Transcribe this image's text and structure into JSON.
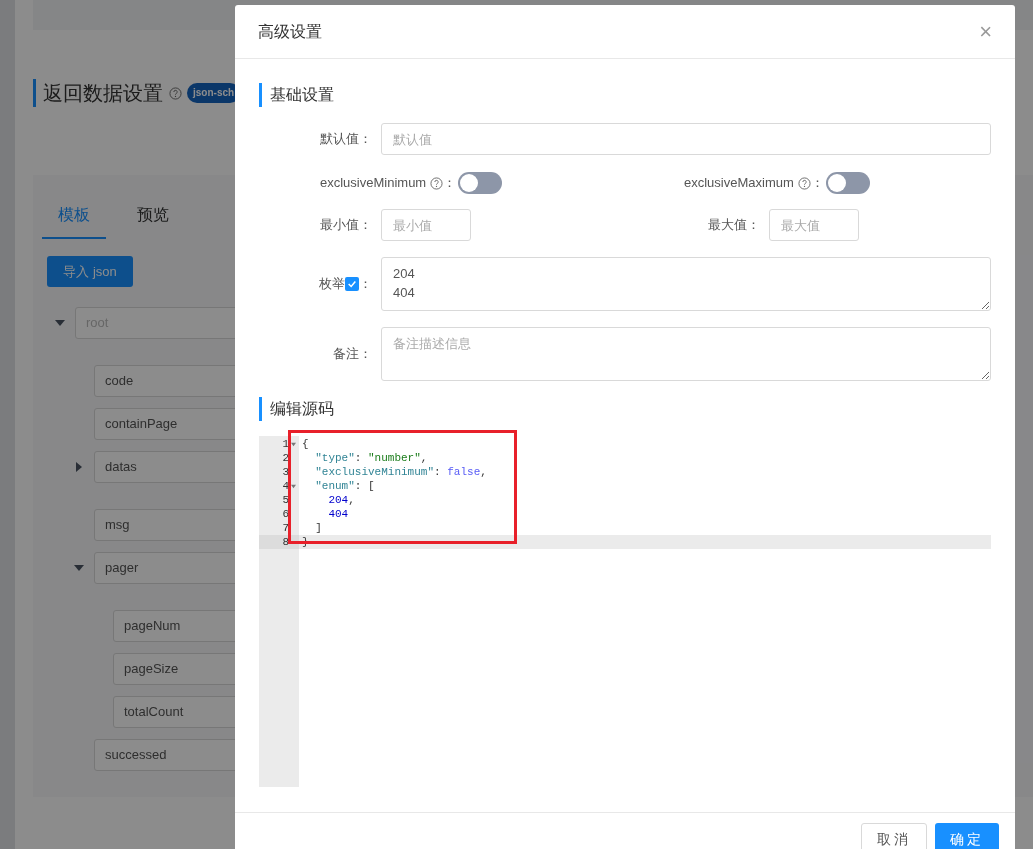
{
  "background": {
    "section_title": "返回数据设置",
    "badge": "json-sch",
    "tabs": [
      {
        "label": "模板",
        "selected": true
      },
      {
        "label": "预览",
        "selected": false
      }
    ],
    "import_button": "导入 json",
    "tree": [
      {
        "name": "root",
        "expanded": true,
        "children": [
          {
            "name": "code"
          },
          {
            "name": "containPage"
          },
          {
            "name": "datas",
            "expanded": false
          },
          {
            "name": "msg"
          },
          {
            "name": "pager",
            "expanded": true,
            "children": [
              {
                "name": "pageNum"
              },
              {
                "name": "pageSize"
              },
              {
                "name": "totalCount"
              }
            ]
          },
          {
            "name": "successed"
          }
        ]
      }
    ]
  },
  "dialog": {
    "title": "高级设置",
    "close": "×",
    "basic_title": "基础设置",
    "default_value": {
      "label": "默认值：",
      "placeholder": "默认值"
    },
    "toggles": [
      {
        "label": "exclusiveMinimum",
        "suffix": "：",
        "on": false
      },
      {
        "label": "exclusiveMaximum",
        "suffix": "：",
        "on": false
      }
    ],
    "min": {
      "label": "最小值：",
      "placeholder": "最小值"
    },
    "max": {
      "label": "最大值：",
      "placeholder": "最大值"
    },
    "enum": {
      "label": "枚举",
      "suffix": "：",
      "checked": true,
      "value": "204\n404"
    },
    "remark": {
      "label": "备注：",
      "placeholder": "备注描述信息"
    },
    "code_title": "编辑源码",
    "code_lines": [
      {
        "number": "1",
        "foldable": true,
        "active": false,
        "tokens": [
          {
            "kind": "punct",
            "text": "{"
          }
        ]
      },
      {
        "number": "2",
        "foldable": false,
        "active": false,
        "tokens": [
          {
            "kind": "key",
            "text": "  \"type\""
          },
          {
            "kind": "punct",
            "text": ": "
          },
          {
            "kind": "string",
            "text": "\"number\""
          },
          {
            "kind": "punct",
            "text": ","
          }
        ]
      },
      {
        "number": "3",
        "foldable": false,
        "active": false,
        "tokens": [
          {
            "kind": "key",
            "text": "  \"exclusiveMinimum\""
          },
          {
            "kind": "punct",
            "text": ": "
          },
          {
            "kind": "boolean",
            "text": "false"
          },
          {
            "kind": "punct",
            "text": ","
          }
        ]
      },
      {
        "number": "4",
        "foldable": true,
        "active": false,
        "tokens": [
          {
            "kind": "key",
            "text": "  \"enum\""
          },
          {
            "kind": "punct",
            "text": ": ["
          }
        ]
      },
      {
        "number": "5",
        "foldable": false,
        "active": false,
        "tokens": [
          {
            "kind": "number",
            "text": "    204"
          },
          {
            "kind": "punct",
            "text": ","
          }
        ]
      },
      {
        "number": "6",
        "foldable": false,
        "active": false,
        "tokens": [
          {
            "kind": "number",
            "text": "    404"
          }
        ]
      },
      {
        "number": "7",
        "foldable": false,
        "active": false,
        "tokens": [
          {
            "kind": "punct",
            "text": "  ]"
          }
        ]
      },
      {
        "number": "8",
        "foldable": false,
        "active": true,
        "tokens": [
          {
            "kind": "punct",
            "text": "}"
          }
        ]
      }
    ],
    "buttons": [
      {
        "label": "取消",
        "kind": "default"
      },
      {
        "label": "确定",
        "kind": "primary"
      }
    ]
  }
}
